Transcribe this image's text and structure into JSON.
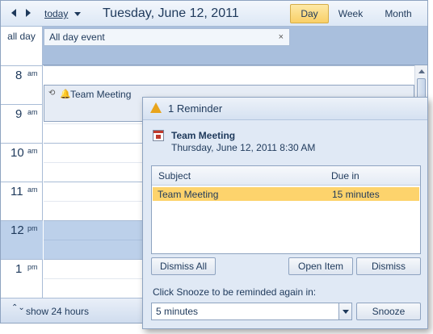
{
  "calendar": {
    "today_label": "today",
    "date_title": "Tuesday, June 12, 2011",
    "views": {
      "day": "Day",
      "week": "Week",
      "month": "Month",
      "selected": "Day"
    },
    "allday_label": "all day",
    "allday_event": {
      "title": "All day event",
      "close": "×"
    },
    "hours": [
      {
        "num": "8",
        "ampm": "am"
      },
      {
        "num": "9",
        "ampm": "am"
      },
      {
        "num": "10",
        "ampm": "am"
      },
      {
        "num": "11",
        "ampm": "am"
      },
      {
        "num": "12",
        "ampm": "pm"
      },
      {
        "num": "1",
        "ampm": "pm"
      }
    ],
    "event": {
      "title": "Team Meeting",
      "recurring_icon": "⟲",
      "bell_icon": "🔔"
    },
    "footer_icon": "⌃⌄",
    "footer_label": "show 24 hours"
  },
  "reminder": {
    "title": "1 Reminder",
    "header_icon": "bell-warning-icon",
    "subject": "Team Meeting",
    "start_time": "Thursday, June 12, 2011 8:30 AM",
    "columns": {
      "subject": "Subject",
      "due_in": "Due in"
    },
    "rows": [
      {
        "subject": "Team Meeting",
        "due_in": "15 minutes",
        "selected": true
      }
    ],
    "buttons": {
      "dismiss_all": "Dismiss All",
      "open_item": "Open Item",
      "dismiss": "Dismiss",
      "snooze": "Snooze"
    },
    "snooze_label": "Click Snooze to be reminded again in:",
    "snooze_value": "5 minutes"
  },
  "colors": {
    "accent": "#1e395b",
    "selected_view": "#f9cf67",
    "selected_row": "#fdd36c",
    "allday_bg": "#a9bfdd",
    "noon_bg": "#bcd0ea"
  }
}
